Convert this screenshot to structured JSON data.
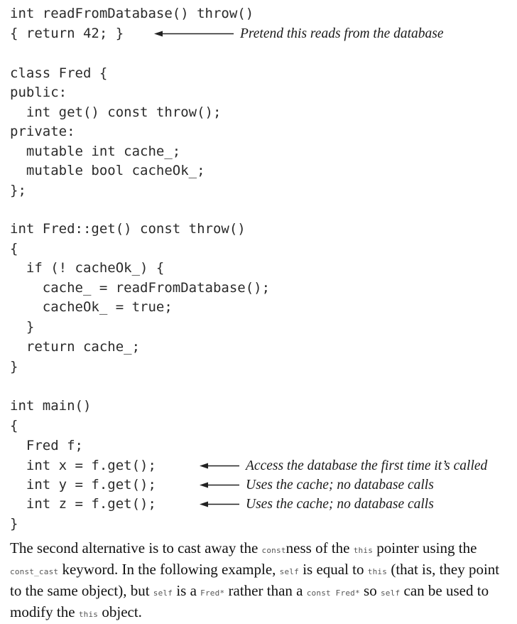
{
  "code": {
    "lines": [
      "int readFromDatabase() throw()",
      "{ return 42; }",
      "",
      "class Fred {",
      "public:",
      "  int get() const throw();",
      "private:",
      "  mutable int cache_;",
      "  mutable bool cacheOk_;",
      "};",
      "",
      "int Fred::get() const throw()",
      "{",
      "  if (! cacheOk_) {",
      "    cache_ = readFromDatabase();",
      "    cacheOk_ = true;",
      "  }",
      "  return cache_;",
      "}",
      "",
      "int main()",
      "{",
      "  Fred f;",
      "  int x = f.get();",
      "  int y = f.get();",
      "  int z = f.get();",
      "}"
    ],
    "annotations": [
      "Pretend this reads from the database",
      "Access the database the first time it’s called",
      "Uses the cache; no database calls",
      "Uses the cache; no database calls"
    ]
  },
  "paragraph": {
    "t1": "The second alternative is to cast away the ",
    "c1": "const",
    "t2": "ness of the ",
    "c2": "this",
    "t3": " pointer using the ",
    "c3": "const_cast",
    "t4": " keyword. In the following example, ",
    "c4": "self",
    "t5": " is equal to ",
    "c5": "this",
    "t6": " (that is, they point to the same object), but ",
    "c6": "self",
    "t7": " is a ",
    "c7": "Fred*",
    "t8": " rather than a ",
    "c8": "const Fred*",
    "t9": " so ",
    "c9": "self",
    "t10": " can be used to modify the ",
    "c10": "this",
    "t11": " object."
  }
}
